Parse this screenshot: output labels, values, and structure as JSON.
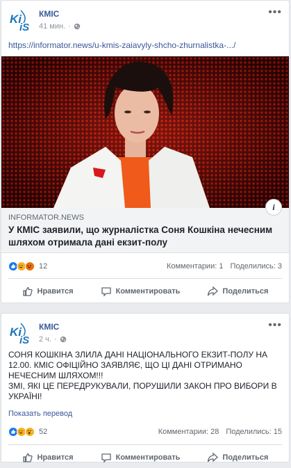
{
  "posts": [
    {
      "page_name": "КМІС",
      "time": "41 мин.",
      "link": "https://informator.news/u-kmis-zaiavyly-shcho-zhurnalistka-.../",
      "preview": {
        "domain": "INFORMATOR.NEWS",
        "title": "У КМІС заявили, що журналістка Соня Кошкіна нечесним шляхом отримала дані екзит-полу"
      },
      "reactions": {
        "count": "12",
        "types": [
          "like-icon",
          "haha-icon",
          "angry-icon"
        ]
      },
      "comments": "Комментарии: 1",
      "shares": "Поделились: 3",
      "actions": {
        "like": "Нравится",
        "comment": "Комментировать",
        "share": "Поделиться"
      }
    },
    {
      "page_name": "КМІС",
      "time": "2 ч.",
      "text_line1": "СОНЯ КОШКІНА ЗЛИЛА ДАНІ НАЦІОНАЛЬНОГО ЕКЗИТ-ПОЛУ НА 12.00. КМІС ОФІЦІЙНО ЗАЯВЛЯЄ, ЩО ЦІ ДАНІ ОТРИМАНО НЕЧЕСНИМ ШЛЯХОМ!!!",
      "text_line2": "ЗМІ, ЯКІ ЦЕ ПЕРЕДРУКУВАЛИ, ПОРУШИЛИ ЗАКОН ПРО ВИБОРИ В УКРАЇНІ!",
      "translate": "Показать перевод",
      "reactions": {
        "count": "52",
        "types": [
          "like-icon",
          "haha-icon",
          "wow-icon"
        ]
      },
      "comments": "Комментарии: 28",
      "shares": "Поделились: 15",
      "actions": {
        "like": "Нравится",
        "comment": "Комментировать",
        "share": "Поделиться"
      }
    }
  ],
  "colors": {
    "link": "#385898",
    "like": "#1877f2",
    "haha": "#f7b125",
    "angry": "#e9710f"
  }
}
